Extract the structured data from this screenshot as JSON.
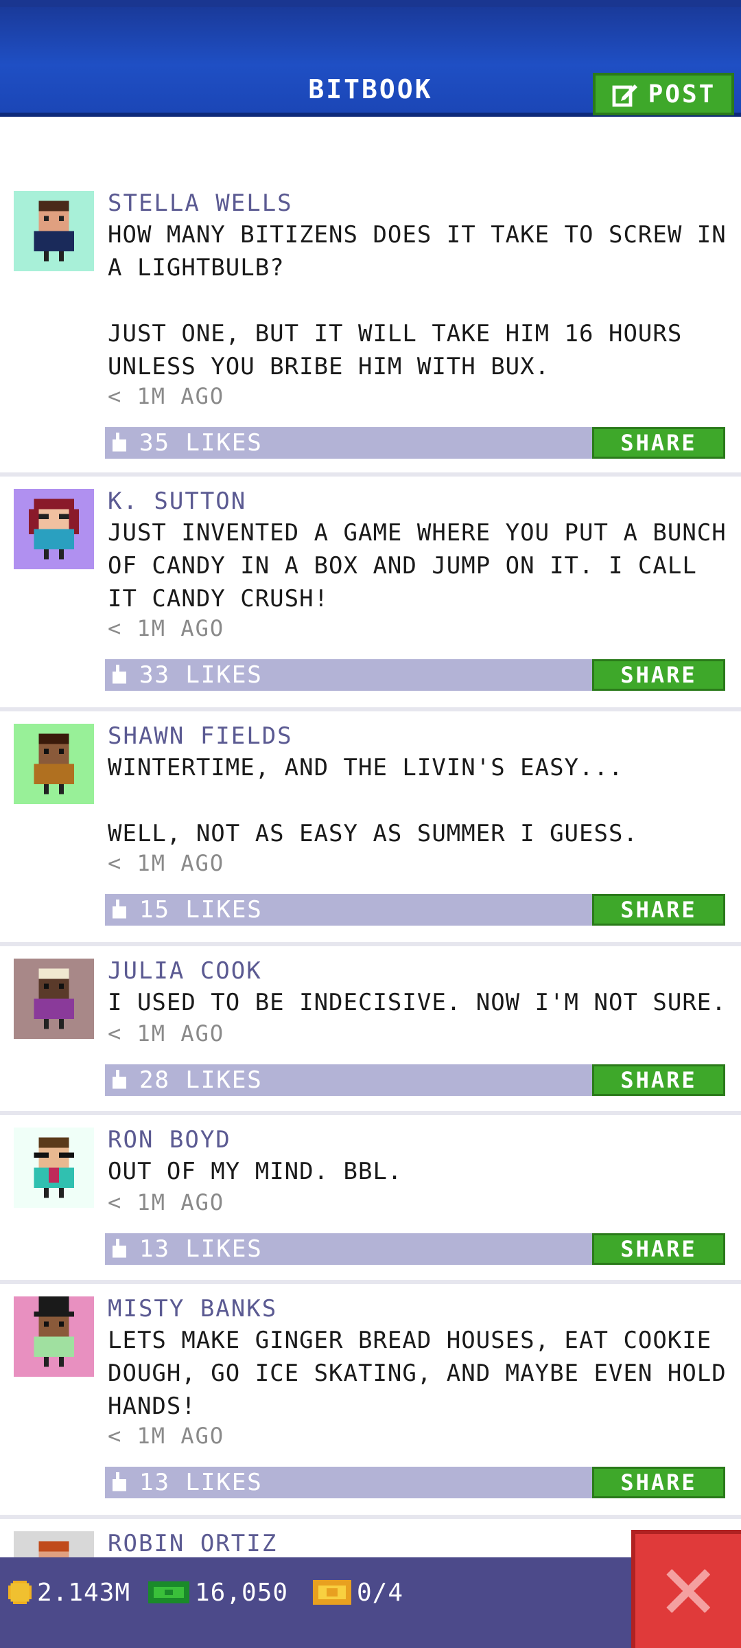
{
  "header": {
    "title": "BITBOOK",
    "post_label": "POST"
  },
  "posts": [
    {
      "author": "STELLA WELLS",
      "text": "HOW MANY BITIZENS DOES IT TAKE TO SCREW IN A LIGHTBULB?\n\nJUST ONE, BUT IT WILL TAKE HIM 16 HOURS UNLESS YOU BRIBE HIM WITH BUX.",
      "time": "< 1M AGO",
      "likes": "35 LIKES",
      "share": "SHARE",
      "avatar_bg": "#a8f0d8"
    },
    {
      "author": "K. SUTTON",
      "text": "JUST INVENTED A GAME WHERE YOU PUT A BUNCH OF CANDY IN A BOX AND JUMP ON IT. I CALL IT CANDY CRUSH!",
      "time": "< 1M AGO",
      "likes": "33 LIKES",
      "share": "SHARE",
      "avatar_bg": "#b090f0"
    },
    {
      "author": "SHAWN FIELDS",
      "text": "WINTERTIME, AND THE LIVIN'S EASY...\n\nWELL, NOT AS EASY AS SUMMER I GUESS.",
      "time": "< 1M AGO",
      "likes": "15 LIKES",
      "share": "SHARE",
      "avatar_bg": "#98f098"
    },
    {
      "author": "JULIA COOK",
      "text": "I USED TO BE INDECISIVE. NOW I'M NOT SURE.",
      "time": "< 1M AGO",
      "likes": "28 LIKES",
      "share": "SHARE",
      "avatar_bg": "#a88888"
    },
    {
      "author": "RON BOYD",
      "text": "OUT OF MY MIND. BBL.",
      "time": "< 1M AGO",
      "likes": "13 LIKES",
      "share": "SHARE",
      "avatar_bg": "#f0fff8"
    },
    {
      "author": "MISTY BANKS",
      "text": "LETS MAKE GINGER BREAD HOUSES, EAT COOKIE DOUGH, GO ICE SKATING, AND MAYBE EVEN HOLD HANDS!",
      "time": "< 1M AGO",
      "likes": "13 LIKES",
      "share": "SHARE",
      "avatar_bg": "#e890c0"
    },
    {
      "author": "ROBIN ORTIZ",
      "text": "",
      "time": "",
      "likes": "",
      "share": "",
      "avatar_bg": "#d8d8d8"
    }
  ],
  "status_bar": {
    "coins": "2.143M",
    "bux": "16,050",
    "tickets": "0/4"
  },
  "colors": {
    "header": "#1f4fc4",
    "accent_green": "#3ea82a",
    "like_bar": "#b3b3d6",
    "author": "#5b5a92",
    "close": "#e03a3a"
  },
  "icons": {
    "post": "edit-icon",
    "like": "thumbs-up-icon",
    "coins": "coin-icon",
    "bux": "bux-icon",
    "tickets": "ticket-icon",
    "close": "close-icon"
  }
}
